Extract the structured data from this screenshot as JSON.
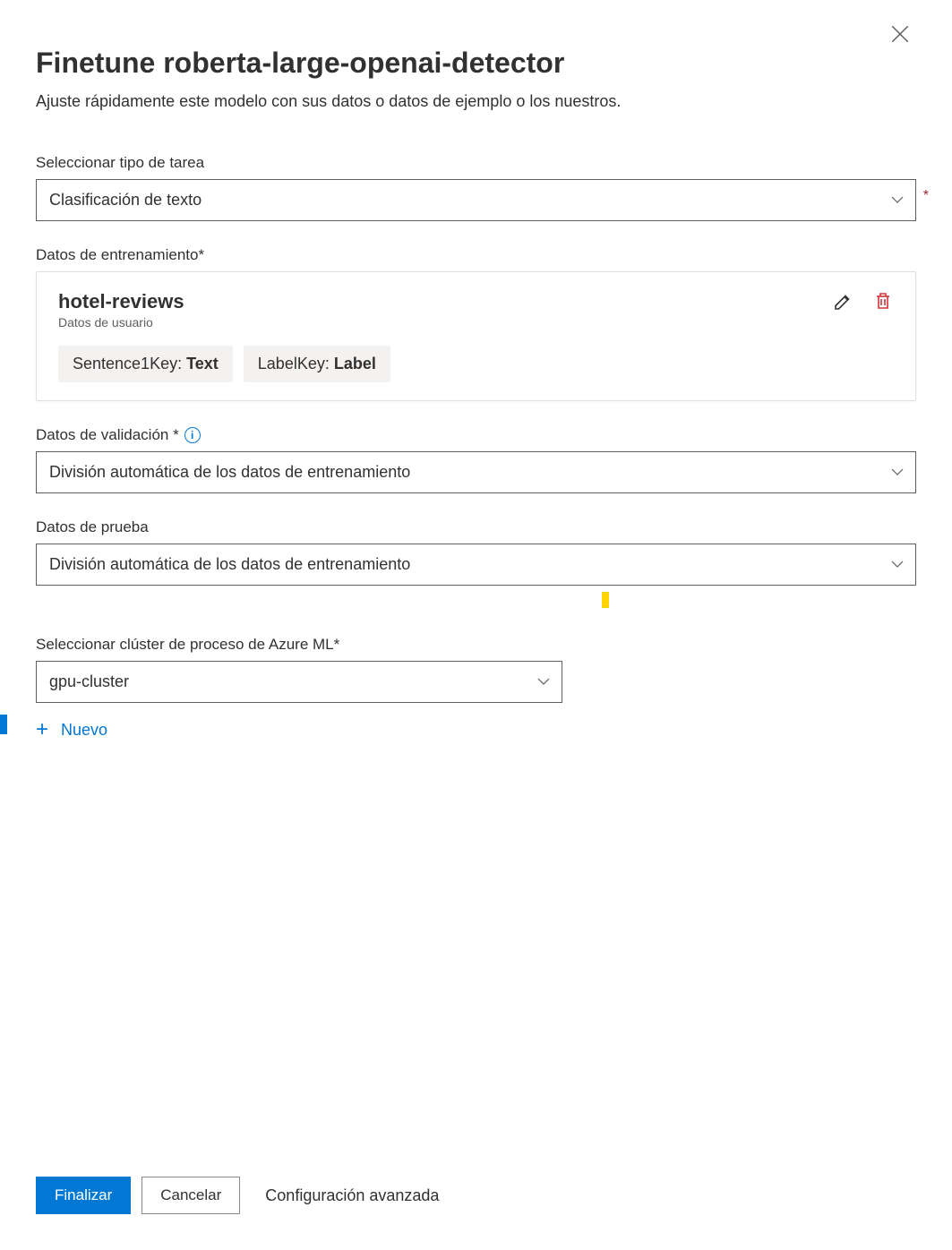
{
  "header": {
    "title": "Finetune roberta-large-openai-detector",
    "subtitle": "Ajuste rápidamente este modelo con sus datos o datos de ejemplo o los nuestros."
  },
  "task_type": {
    "label": "Seleccionar tipo de tarea",
    "value": "Clasificación de texto"
  },
  "training_data": {
    "label": "Datos de entrenamiento*",
    "card": {
      "name": "hotel-reviews",
      "subtitle": "Datos de usuario",
      "sentence_key_label": "Sentence1Key: ",
      "sentence_key_value": "Text",
      "label_key_label": "LabelKey: ",
      "label_key_value": "Label"
    }
  },
  "validation_data": {
    "label": "Datos de validación *",
    "value": "División automática de los datos de entrenamiento"
  },
  "test_data": {
    "label": "Datos de prueba",
    "value": "División automática de los datos de entrenamiento"
  },
  "compute": {
    "label": "Seleccionar clúster de proceso de Azure ML*",
    "value": "gpu-cluster",
    "new_label": "Nuevo"
  },
  "footer": {
    "finish": "Finalizar",
    "cancel": "Cancelar",
    "advanced": "Configuración avanzada"
  }
}
